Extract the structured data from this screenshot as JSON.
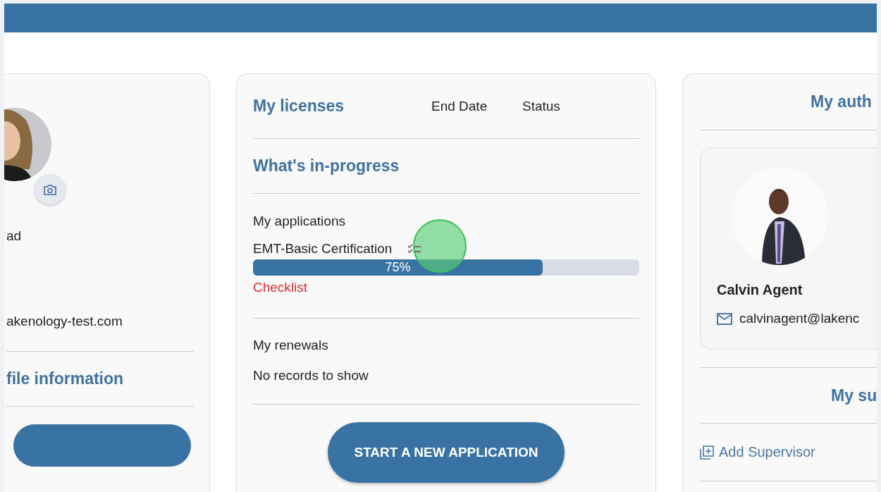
{
  "profile_card": {
    "address_fragment": "ad",
    "email": "akenology-test.com",
    "section_heading": "file information"
  },
  "licenses_card": {
    "title": "My licenses",
    "columns": [
      "End Date",
      "Status"
    ],
    "in_progress_heading": "What's in-progress",
    "applications_heading": "My applications",
    "applications": [
      {
        "name": "EMT-Basic Certification",
        "level": 0.75,
        "progress_label": "75%",
        "link": "Checklist"
      }
    ],
    "renewals_heading": "My renewals",
    "renewals_empty": "No records to show",
    "button": "START A NEW APPLICATION"
  },
  "authority_card": {
    "title": "My auth",
    "agent": {
      "name": "Calvin Agent",
      "email": "calvinagent@lakenc"
    },
    "supervisors_heading": "My su",
    "add_button": "Add Supervisor"
  }
}
